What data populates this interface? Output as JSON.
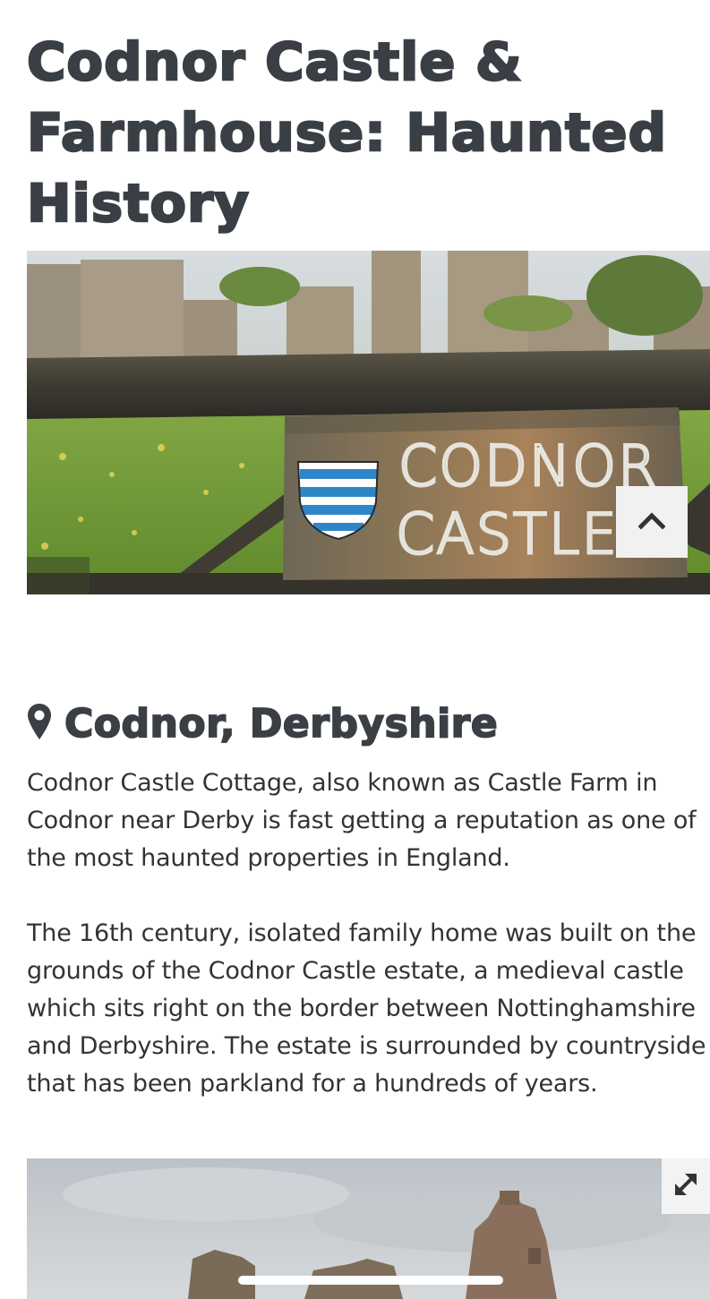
{
  "article": {
    "title": "Codnor Castle & Farmhouse: Haunted History",
    "location": "Codnor, Derbyshire",
    "paragraphs": [
      "Codnor Castle Cottage, also known as Castle Farm in Codnor near Derby is fast getting a reputation as one of the most haunted properties in England.",
      "The 16th century, isolated family home was built on the grounds of the Codnor Castle estate, a medieval castle which sits right on the border between Nottinghamshire and Derbyshire. The estate is surrounded by countryside that has been parkland for a hundreds of years."
    ]
  },
  "hero_image": {
    "sign_line1": "CODNOR",
    "sign_line2": "CASTLE"
  },
  "icons": {
    "location": "map-pin-icon",
    "back_to_top": "chevron-up-icon",
    "expand": "expand-arrows-icon"
  },
  "colors": {
    "heading": "#3a3f45",
    "body_text": "#333333",
    "button_bg": "#f1f1f1"
  }
}
